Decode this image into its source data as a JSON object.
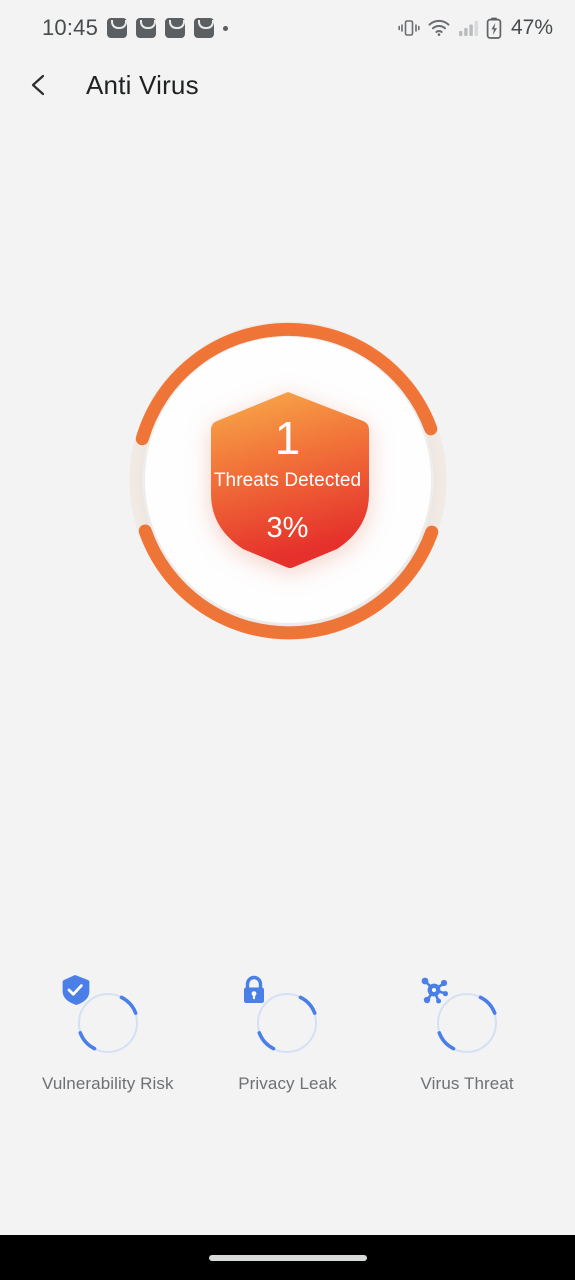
{
  "status_bar": {
    "clock": "10:45",
    "notification_icons": [
      "mail-icon",
      "mail-icon",
      "mail-icon",
      "mail-icon"
    ],
    "overflow_dot": "more-notifications-dot",
    "system_icons": [
      "vibrate-icon",
      "wifi-icon",
      "cellular-signal-icon",
      "battery-charging-icon"
    ],
    "battery_percent": "47%"
  },
  "header": {
    "back_icon": "chevron-left-icon",
    "title": "Anti Virus"
  },
  "scan": {
    "threat_count": "1",
    "threat_label": "Threats Detected",
    "threat_percent": "3%",
    "progress_value": 3,
    "arc_color": "#f07537",
    "track_color": "#f1eae5",
    "shield_gradient_start": "#f7a645",
    "shield_gradient_end": "#e8342c",
    "inner_circle_color": "#fefefe"
  },
  "categories": [
    {
      "id": "vulnerability-risk",
      "label": "Vulnerability Risk",
      "icon": "shield-check-icon",
      "color": "#4a7fe8"
    },
    {
      "id": "privacy-leak",
      "label": "Privacy Leak",
      "icon": "lock-icon",
      "color": "#4a7fe8"
    },
    {
      "id": "virus-threat",
      "label": "Virus Threat",
      "icon": "virus-icon",
      "color": "#4a7fe8"
    }
  ],
  "nav_bar": {
    "home_indicator": "home-gesture-pill"
  },
  "theme": {
    "page_background": "#f2f3f2",
    "title_color": "#1f2123",
    "label_color": "#6d7175",
    "nav_background": "#000000"
  }
}
